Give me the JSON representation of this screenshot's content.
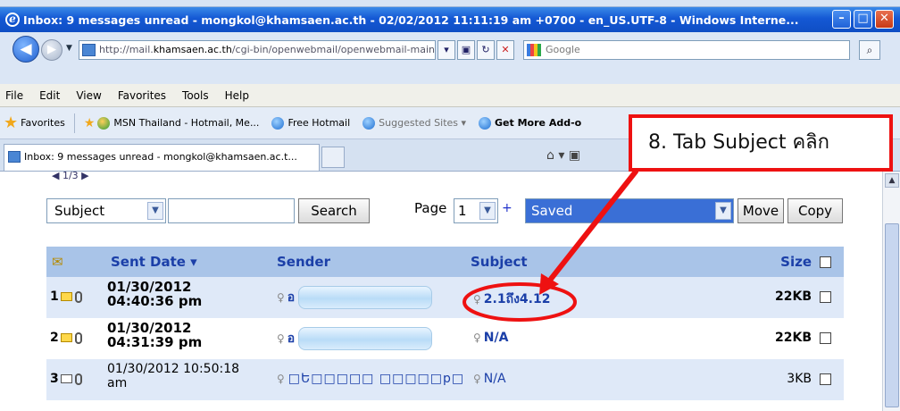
{
  "window": {
    "title": "Inbox: 9 messages unread - mongkol@khamsaen.ac.th - 02/02/2012 11:11:19 am +0700 - en_US.UTF-8 - Windows Interne...",
    "minimize": "–",
    "maximize": "□",
    "close": "✕"
  },
  "address": {
    "url_prefix": "http://mail.",
    "url_domain": "khamsaen.ac.th",
    "url_suffix": "/cgi-bin/openwebmail/openwebmail-main.pl?sess",
    "search_placeholder": "Google"
  },
  "menu": [
    "File",
    "Edit",
    "View",
    "Favorites",
    "Tools",
    "Help"
  ],
  "favorites": {
    "label": "Favorites",
    "items": [
      "MSN Thailand - Hotmail, Me...",
      "Free Hotmail",
      "Suggested Sites ▾",
      "Get More Add-o"
    ]
  },
  "tab": {
    "title": "Inbox: 9 messages unread - mongkol@khamsaen.ac.t..."
  },
  "toolbar": {
    "pager": "◀ 1/3 ▶",
    "search_field": "Subject",
    "search_button": "Search",
    "page_label": "Page",
    "page_value": "1",
    "plus": "+",
    "folder": "Saved",
    "move_button": "Move",
    "copy_button": "Copy"
  },
  "table": {
    "headers": {
      "date": "Sent Date ▾",
      "sender": "Sender",
      "subject": "Subject",
      "size": "Size"
    },
    "rows": [
      {
        "num": "1",
        "date": "01/30/2012 04:40:36 pm",
        "sender": "อ",
        "subject": "2.1ถึง4.12",
        "size": "22KB"
      },
      {
        "num": "2",
        "date": "01/30/2012 04:31:39 pm",
        "sender": "อ",
        "subject": "N/A",
        "size": "22KB"
      },
      {
        "num": "3",
        "date": "01/30/2012 10:50:18 am",
        "sender": "□Ե□□□□□ □□□□□p□",
        "subject": "N/A",
        "size": "3KB"
      }
    ]
  },
  "callout": {
    "text": "8. Tab Subject คลิก",
    "color": "#ee1111"
  }
}
